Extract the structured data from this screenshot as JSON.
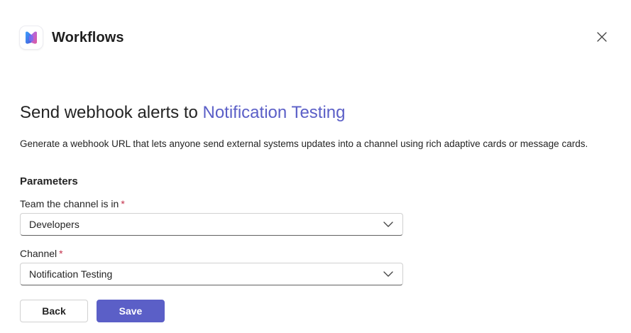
{
  "header": {
    "app_title": "Workflows",
    "app_icon": "workflows-logo-icon",
    "close_icon": "close-icon"
  },
  "main": {
    "heading_prefix": "Send webhook alerts to ",
    "heading_accent": "Notification Testing",
    "description": "Generate a webhook URL that lets anyone send external systems updates into a channel using rich adaptive cards or message cards.",
    "section_title": "Parameters",
    "fields": [
      {
        "label": "Team the channel is in",
        "required_mark": "*",
        "value": "Developers",
        "icon": "chevron-down-icon"
      },
      {
        "label": "Channel",
        "required_mark": "*",
        "value": "Notification Testing",
        "icon": "chevron-down-icon"
      }
    ]
  },
  "actions": {
    "back_label": "Back",
    "save_label": "Save"
  },
  "colors": {
    "accent": "#5b5fc7",
    "required": "#c4314b",
    "text": "#242424"
  }
}
